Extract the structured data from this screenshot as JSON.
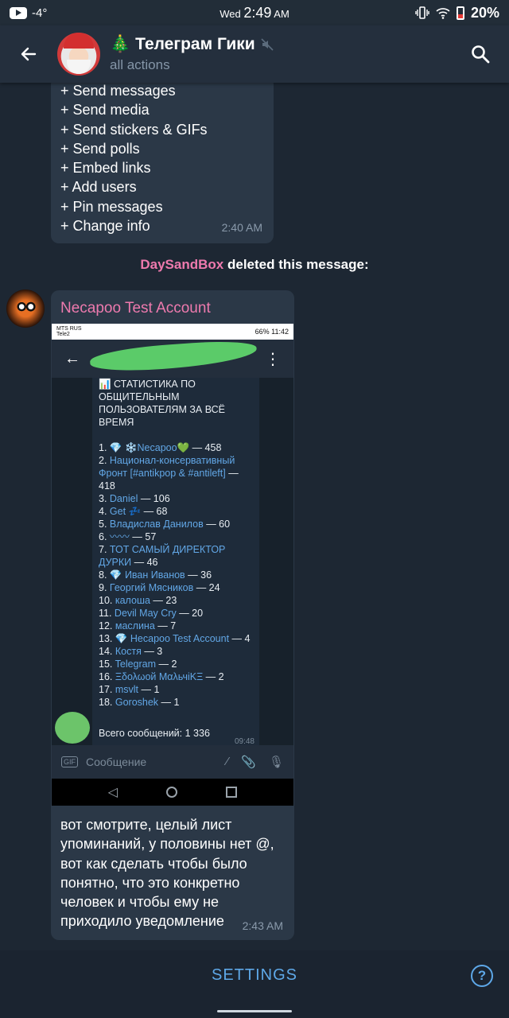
{
  "status_bar": {
    "temperature": "-4°",
    "day": "Wed",
    "time": "2:49",
    "ampm": "AM",
    "battery": "20%"
  },
  "header": {
    "title": "Телеграм Гики",
    "subtitle": "all actions",
    "title_emoji": "🎄"
  },
  "permissions": {
    "items": [
      "+ Send messages",
      "+ Send media",
      "+ Send stickers & GIFs",
      "+ Send polls",
      "+ Embed links",
      "+ Add users",
      "+ Pin messages",
      "+ Change info"
    ],
    "time": "2:40 AM"
  },
  "service": {
    "actor": "DaySandBox",
    "action": "deleted this message:"
  },
  "message": {
    "sender": "Necapoo Test Account",
    "text": "вот смотрите, целый лист упоминаний, у половины нет @, вот как сделать чтобы было понятно, что это конкретно человек и чтобы ему не приходило уведомление",
    "time": "2:43 AM"
  },
  "screenshot": {
    "carrier": "MTS RUS",
    "carrier2": "Tele2",
    "status_right": "66% 11:42",
    "stats_title": "📊 СТАТИСТИКА ПО ОБЩИТЕЛЬНЫМ ПОЛЬЗОВАТЕЛЯМ ЗА ВСЁ ВРЕМЯ",
    "entries": [
      {
        "n": "1.",
        "name": "💎 ❄️Necapoo💚",
        "val": " — 458"
      },
      {
        "n": "2.",
        "name": "Национал-консервативный Фронт [#antikpop & #antileft]",
        "val": " — 418"
      },
      {
        "n": "3.",
        "name": "Daniel",
        "val": " — 106"
      },
      {
        "n": "4.",
        "name": "Get 💤",
        "val": " — 68"
      },
      {
        "n": "5.",
        "name": "Владислав Данилов",
        "val": " — 60"
      },
      {
        "n": "6.",
        "name": "〰〰",
        "val": " — 57"
      },
      {
        "n": "7.",
        "name": "ТОТ САМЫЙ ДИРЕКТОР ДУРКИ",
        "val": " — 46"
      },
      {
        "n": "8.",
        "name": "💎 Иван Иванов",
        "val": " — 36"
      },
      {
        "n": "9.",
        "name": "Георгий Мясников",
        "val": " — 24"
      },
      {
        "n": "10.",
        "name": "калоша",
        "val": " — 23"
      },
      {
        "n": "11.",
        "name": "Devil May Cry",
        "val": " — 20"
      },
      {
        "n": "12.",
        "name": "маслина",
        "val": " — 7"
      },
      {
        "n": "13.",
        "name": "💎 Hecapoo Test Account",
        "val": " — 4"
      },
      {
        "n": "14.",
        "name": "Костя",
        "val": " — 3"
      },
      {
        "n": "15.",
        "name": "Telegram",
        "val": " — 2"
      },
      {
        "n": "16.",
        "name": "Ξδολωοй ΜαλьчiΚΞ",
        "val": " — 2"
      },
      {
        "n": "17.",
        "name": "msvlt",
        "val": " — 1"
      },
      {
        "n": "18.",
        "name": "Goroshek",
        "val": " — 1"
      }
    ],
    "total": "Всего сообщений: 1 336",
    "msg_time": "09:48",
    "input_placeholder": "Сообщение",
    "gif_label": "GIF"
  },
  "bottom": {
    "settings_label": "SETTINGS",
    "help_label": "?"
  },
  "colors": {
    "accent": "#5ea8e8",
    "sender_pink": "#ee7aae",
    "bubble": "#2b3847",
    "background": "#1d2733"
  },
  "icons": [
    "youtube-icon",
    "back-arrow-icon",
    "search-icon",
    "muted-icon",
    "vibrate-icon",
    "wifi-icon",
    "battery-icon",
    "help-icon"
  ]
}
